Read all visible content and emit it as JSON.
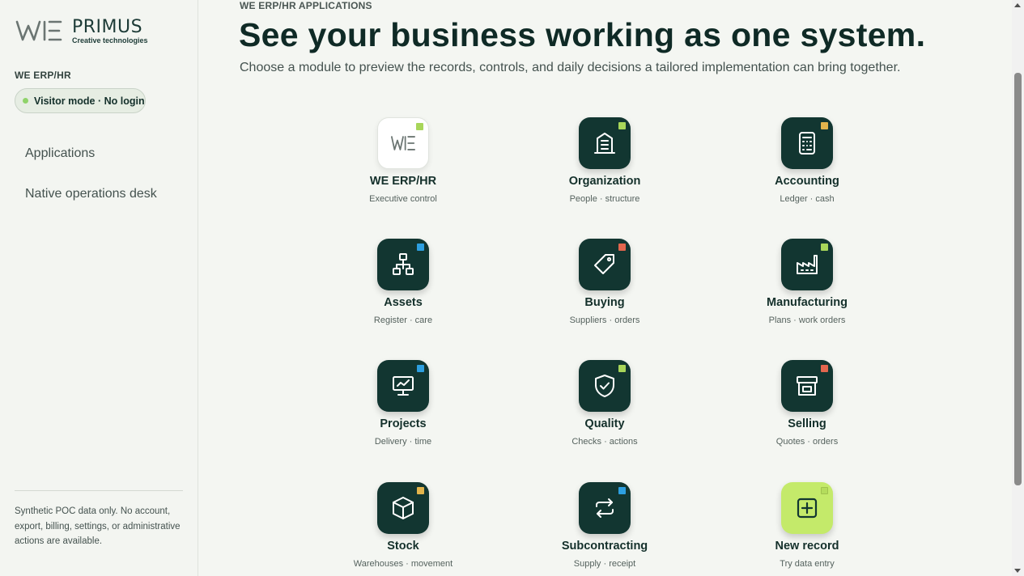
{
  "sidebar": {
    "logo_primus": "PRIMUS",
    "logo_sub": "Creative technologies",
    "section_label": "WE ERP/HR",
    "visitor_mode": "Visitor mode · No login",
    "nav": [
      {
        "label": "Applications"
      },
      {
        "label": "Native operations desk"
      }
    ],
    "footer_note": "Synthetic POC data only. No account, export, billing, settings, or administrative actions are available."
  },
  "main": {
    "eyebrow": "WE ERP/HR APPLICATIONS",
    "headline": "See your business working as one system.",
    "subline": "Choose a module to preview the records, controls, and daily decisions a tailored implementation can bring together."
  },
  "apps": [
    {
      "name": "WE ERP/HR",
      "sub": "Executive control",
      "icon": "we-logo-icon",
      "badge": "#a8d65a"
    },
    {
      "name": "Organization",
      "sub": "People · structure",
      "icon": "building-icon",
      "badge": "#a8d65a"
    },
    {
      "name": "Accounting",
      "sub": "Ledger · cash",
      "icon": "calculator-icon",
      "badge": "#e2b44c"
    },
    {
      "name": "Assets",
      "sub": "Register · care",
      "icon": "hierarchy-icon",
      "badge": "#2d9fe0"
    },
    {
      "name": "Buying",
      "sub": "Suppliers · orders",
      "icon": "tag-icon",
      "badge": "#e2664e"
    },
    {
      "name": "Manufacturing",
      "sub": "Plans · work orders",
      "icon": "factory-icon",
      "badge": "#a8d65a"
    },
    {
      "name": "Projects",
      "sub": "Delivery · time",
      "icon": "monitor-chart-icon",
      "badge": "#2d9fe0"
    },
    {
      "name": "Quality",
      "sub": "Checks · actions",
      "icon": "shield-check-icon",
      "badge": "#a8d65a"
    },
    {
      "name": "Selling",
      "sub": "Quotes · orders",
      "icon": "archive-box-icon",
      "badge": "#e2664e"
    },
    {
      "name": "Stock",
      "sub": "Warehouses · movement",
      "icon": "cube-icon",
      "badge": "#e2b44c"
    },
    {
      "name": "Subcontracting",
      "sub": "Supply · receipt",
      "icon": "repeat-arrows-icon",
      "badge": "#2d9fe0"
    },
    {
      "name": "New record",
      "sub": "Try data entry",
      "icon": "plus-square-icon",
      "badge": "#b4dc5c"
    }
  ]
}
